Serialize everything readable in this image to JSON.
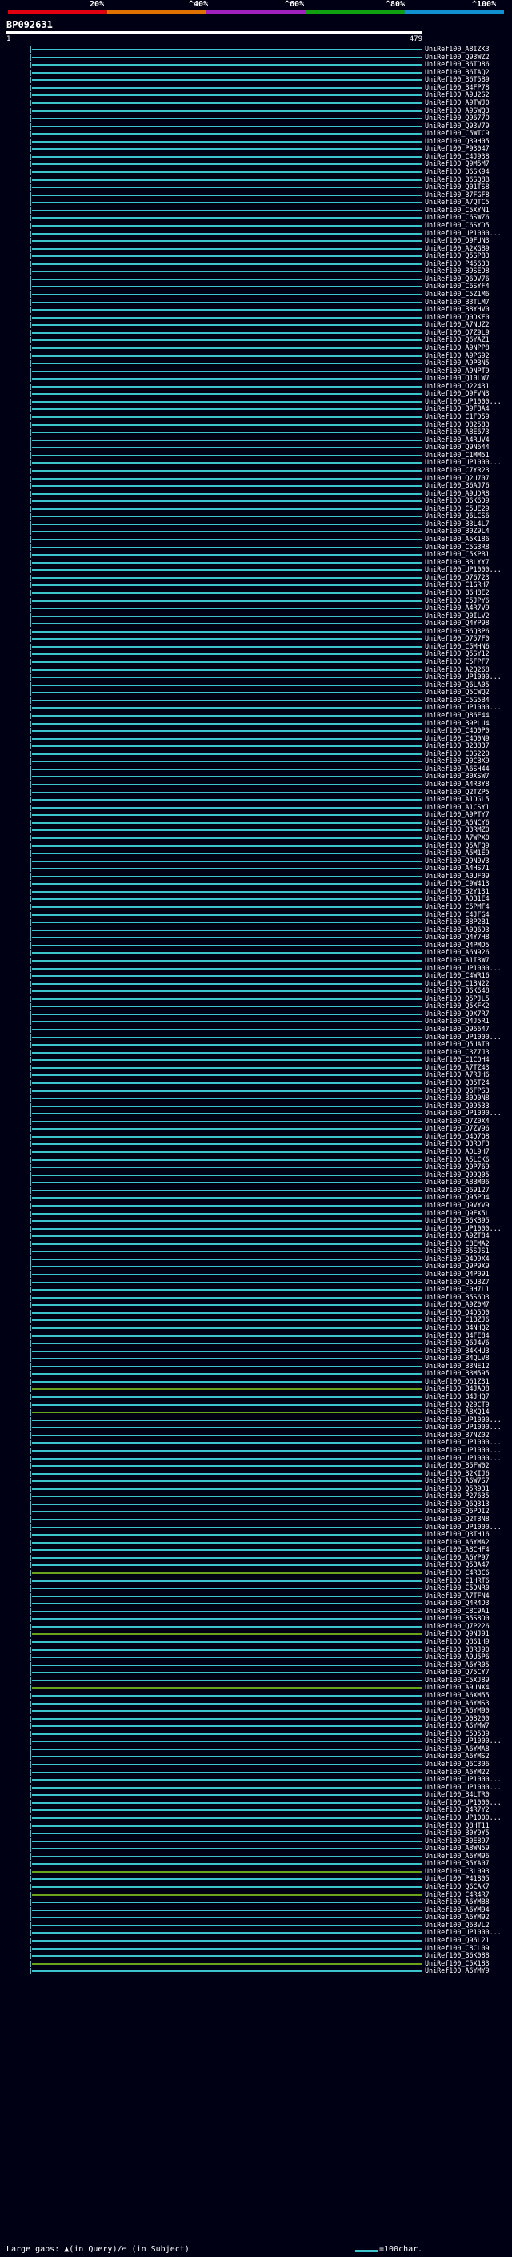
{
  "scale": {
    "labels": [
      "20%",
      "^40%",
      "^60%",
      "^80%",
      "^100%"
    ],
    "colors": [
      "#e00010",
      "#e07000",
      "#a020c0",
      "#10a010",
      "#1090d0"
    ]
  },
  "query": {
    "id": "BP092631",
    "start": "1",
    "end": "479"
  },
  "hits": [
    "UniRef100_A8IZK3",
    "UniRef100_Q93WZ2",
    "UniRef100_B6TD86",
    "UniRef100_B6TAQ2",
    "UniRef100_B6T5B9",
    "UniRef100_B4FP78",
    "UniRef100_A9U2S2",
    "UniRef100_A9TWJ0",
    "UniRef100_A9SWQ3",
    "UniRef100_Q9677O",
    "UniRef100_Q93V79",
    "UniRef100_C5WTC9",
    "UniRef100_Q39H05",
    "UniRef100_P93047",
    "UniRef100_C4J938",
    "UniRef100_Q9M5M7",
    "UniRef100_B6SK94",
    "UniRef100_B6SQ8B",
    "UniRef100_Q01TS8",
    "UniRef100_B7FGF8",
    "UniRef100_A7QTC5",
    "UniRef100_C5XYN1",
    "UniRef100_C6SWZ6",
    "UniRef100_C6SYD5",
    "UniRef100_UP1000...",
    "UniRef100_Q9FUN3",
    "UniRef100_A2XGB9",
    "UniRef100_Q5SPB3",
    "UniRef100_P45633",
    "UniRef100_B9SED8",
    "UniRef100_Q6DV76",
    "UniRef100_C6SYF4",
    "UniRef100_C5Z1M6",
    "UniRef100_B3TLM7",
    "UniRef100_B8YHV0",
    "UniRef100_Q0DKF0",
    "UniRef100_A7NUZ2",
    "UniRef100_Q7Z9L9",
    "UniRef100_Q6YAZ1",
    "UniRef100_A9NPP8",
    "UniRef100_A9PG92",
    "UniRef100_A9PBN5",
    "UniRef100_A9NPT9",
    "UniRef100_Q10LW7",
    "UniRef100_O22431",
    "UniRef100_Q9FVN3",
    "UniRef100_UP1000...",
    "UniRef100_B9FBA4",
    "UniRef100_C1FD59",
    "UniRef100_O82583",
    "UniRef100_A8E673",
    "UniRef100_A4RUV4",
    "UniRef100_Q9N644",
    "UniRef100_C1MM51",
    "UniRef100_UP1000...",
    "UniRef100_C7YR23",
    "UniRef100_Q2U707",
    "UniRef100_B6AJ76",
    "UniRef100_A9UDR8",
    "UniRef100_B6K6D9",
    "UniRef100_C5UE29",
    "UniRef100_Q6LCS6",
    "UniRef100_B3L4L7",
    "UniRef100_B0Z9L4",
    "UniRef100_A5K186",
    "UniRef100_C5G3R8",
    "UniRef100_C5KPB1",
    "UniRef100_B8LYY7",
    "UniRef100_UP1000...",
    "UniRef100_Q76723",
    "UniRef100_C1GRH7",
    "UniRef100_B6H8E2",
    "UniRef100_C5JPY6",
    "UniRef100_A4R7V9",
    "UniRef100_Q0ILV2",
    "UniRef100_Q4YP98",
    "UniRef100_B6Q3P6",
    "UniRef100_Q757F0",
    "UniRef100_C5MHN6",
    "UniRef100_Q5SY12",
    "UniRef100_C5FPF7",
    "UniRef100_A2Q268",
    "UniRef100_UP1000...",
    "UniRef100_Q6LA05",
    "UniRef100_Q5CWQ2",
    "UniRef100_C5G5B4",
    "UniRef100_UP1000...",
    "UniRef100_Q86E44",
    "UniRef100_B9PLU4",
    "UniRef100_C4Q0P0",
    "UniRef100_C4Q0N9",
    "UniRef100_B2B837",
    "UniRef100_C0S220",
    "UniRef100_Q0CBX9",
    "UniRef100_A6SH44",
    "UniRef100_B0XSW7",
    "UniRef100_A4R3Y8",
    "UniRef100_Q2TZP5",
    "UniRef100_A1DGL5",
    "UniRef100_A1CSY1",
    "UniRef100_A9PTY7",
    "UniRef100_A6NCY6",
    "UniRef100_B3RMZ0",
    "UniRef100_A7WPX0",
    "UniRef100_Q5AFQ9",
    "UniRef100_A5M1E9",
    "UniRef100_Q9N9V3",
    "UniRef100_A4HS71",
    "UniRef100_A0UF09",
    "UniRef100_C9W413",
    "UniRef100_B2Y131",
    "UniRef100_A0B1E4",
    "UniRef100_C5PMF4",
    "UniRef100_C4JFG4",
    "UniRef100_B8P2B1",
    "UniRef100_A0Q6D3",
    "UniRef100_Q4Y7H8",
    "UniRef100_Q4PMD5",
    "UniRef100_A6N926",
    "UniRef100_A1I3W7",
    "UniRef100_UP1000...",
    "UniRef100_C4WR16",
    "UniRef100_C1BN22",
    "UniRef100_B6K648",
    "UniRef100_Q5PJL5",
    "UniRef100_Q5KFK2",
    "UniRef100_Q9X7R7",
    "UniRef100_Q4J5R1",
    "UniRef100_Q96647",
    "UniRef100_UP1000...",
    "UniRef100_Q5UAT0",
    "UniRef100_C3Z7J3",
    "UniRef100_C1COH4",
    "UniRef100_A7TZ43",
    "UniRef100_A7RJH6",
    "UniRef100_Q35T24",
    "UniRef100_Q6FPS3",
    "UniRef100_B0D0N8",
    "UniRef100_Q09533",
    "UniRef100_UP1000...",
    "UniRef100_Q7Z0X4",
    "UniRef100_Q7ZV96",
    "UniRef100_Q4D7Q8",
    "UniRef100_B3RDF3",
    "UniRef100_A0L9H7",
    "UniRef100_A5LCK6",
    "UniRef100_Q9P769",
    "UniRef100_Q99Q05",
    "UniRef100_A8BM06",
    "UniRef100_Q69127",
    "UniRef100_Q95PD4",
    "UniRef100_Q9VYV9",
    "UniRef100_Q9FX5L",
    "UniRef100_B6KB95",
    "UniRef100_UP1000...",
    "UniRef100_A9ZT84",
    "UniRef100_C8EMA2",
    "UniRef100_B5SJS1",
    "UniRef100_Q4D9X4",
    "UniRef100_Q9P9X9",
    "UniRef100_Q4P091",
    "UniRef100_Q5UBZ7",
    "UniRef100_C0H7L1",
    "UniRef100_B5S6D3",
    "UniRef100_A9Z0M7",
    "UniRef100_Q4D5D0",
    "UniRef100_C1BZJ6",
    "UniRef100_B4NHQ2",
    "UniRef100_B4FE84",
    "UniRef100_Q6J4V6",
    "UniRef100_B4KHU3",
    "UniRef100_B4QLV8",
    "UniRef100_B3NE12",
    "UniRef100_B3M595",
    "UniRef100_Q61Z31",
    "UniRef100_B4JAD8",
    "UniRef100_B4JHQ7",
    "UniRef100_Q29CT9",
    "UniRef100_A8XQ14",
    "UniRef100_UP1000...",
    "UniRef100_UP1000...",
    "UniRef100_B7NZ02",
    "UniRef100_UP1000...",
    "UniRef100_UP1000...",
    "UniRef100_UP1000...",
    "UniRef100_B5FW02",
    "UniRef100_B2KIJ6",
    "UniRef100_A6W7S7",
    "UniRef100_Q5R931",
    "UniRef100_P27635",
    "UniRef100_Q6Q313",
    "UniRef100_Q6PDI2",
    "UniRef100_Q2TBN8",
    "UniRef100_UP1000...",
    "UniRef100_Q3TH16",
    "UniRef100_A6YMA2",
    "UniRef100_A8CHF4",
    "UniRef100_A6YP97",
    "UniRef100_Q5BA47",
    "UniRef100_C4R3C6",
    "UniRef100_C1HRT6",
    "UniRef100_C5DNR0",
    "UniRef100_A7TFN4",
    "UniRef100_Q4R4D3",
    "UniRef100_C8C9A1",
    "UniRef100_B5S8D0",
    "UniRef100_Q7P226",
    "UniRef100_Q9NJ91",
    "UniRef100_Q861H9",
    "UniRef100_B8RJ90",
    "UniRef100_A9U5P6",
    "UniRef100_A6YR05",
    "UniRef100_Q75CY7",
    "UniRef100_C5XJ89",
    "UniRef100_A9UNX4",
    "UniRef100_A6XM55",
    "UniRef100_A6YMS3",
    "UniRef100_A6YM90",
    "UniRef100_Q08200",
    "UniRef100_A6YMW7",
    "UniRef100_C5D539",
    "UniRef100_UP1000...",
    "UniRef100_A6YMA8",
    "UniRef100_A6YMS2",
    "UniRef100_Q6C306",
    "UniRef100_A6YM22",
    "UniRef100_UP1000...",
    "UniRef100_UP1000...",
    "UniRef100_B4LTR0",
    "UniRef100_UP1000...",
    "UniRef100_Q4R7Y2",
    "UniRef100_UP1000...",
    "UniRef100_Q8HT11",
    "UniRef100_B0Y9Y5",
    "UniRef100_B0E897",
    "UniRef100_A8WN59",
    "UniRef100_A6YM96",
    "UniRef100_B5YA07",
    "UniRef100_C3L093",
    "UniRef100_P41805",
    "UniRef100_Q6CAK7",
    "UniRef100_C4R4R7",
    "UniRef100_A6YMB8",
    "UniRef100_A6YM94",
    "UniRef100_A6YM92",
    "UniRef100_Q6BVL2",
    "UniRef100_UP1000...",
    "UniRef100_Q96L21",
    "UniRef100_C8CL09",
    "UniRef100_B6K088",
    "UniRef100_C5X183",
    "UniRef100_A6YMY9"
  ],
  "legend": {
    "gaps_text": "Large gaps: ▲(in Query)/⌐ (in Subject)",
    "key_label": "=100char."
  }
}
